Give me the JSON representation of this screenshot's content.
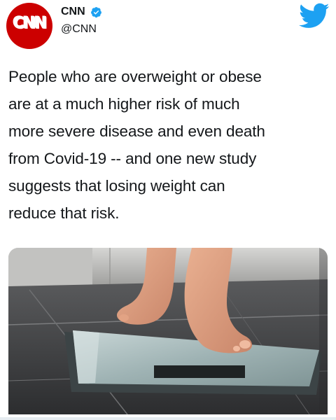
{
  "tweet": {
    "account_name": "CNN",
    "handle": "@CNN",
    "avatar_text": "CNN",
    "verified": true,
    "text_lines": [
      "People who are overweight or obese",
      "are at a much higher risk of much",
      "more severe disease and even death",
      "from Covid-19 -- and one new study",
      "suggests that losing weight can",
      "reduce that risk."
    ]
  },
  "icons": {
    "avatar": "cnn-logo",
    "verified": "verified-badge-icon",
    "platform": "twitter-bird-icon"
  },
  "colors": {
    "brand_red": "#cc0000",
    "verified_blue": "#1da1f2",
    "twitter_blue": "#1da1f2",
    "text": "#14171a"
  }
}
